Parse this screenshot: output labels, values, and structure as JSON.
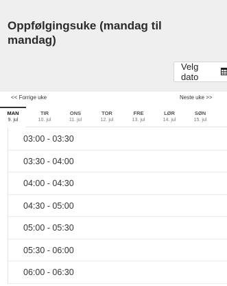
{
  "title": "Oppfølgingsuke (mandag til mandag)",
  "date_button": {
    "label": "Velg dato",
    "icon": "calendar-icon"
  },
  "week_nav": {
    "prev": "<< Forrige uke",
    "next": "Neste uke >>"
  },
  "days": [
    {
      "name": "MAN",
      "date": "9. jul"
    },
    {
      "name": "TIR",
      "date": "10. jul"
    },
    {
      "name": "ONS",
      "date": "11. jul"
    },
    {
      "name": "TOR",
      "date": "12. jul"
    },
    {
      "name": "FRE",
      "date": "13. jul"
    },
    {
      "name": "LØR",
      "date": "14. jul"
    },
    {
      "name": "SØN",
      "date": "15. jul"
    }
  ],
  "slots": [
    "03:00 - 03:30",
    "03:30 - 04:00",
    "04:00 - 04:30",
    "04:30 - 05:00",
    "05:00 - 05:30",
    "05:30 - 06:00",
    "06:00 - 06:30"
  ],
  "colors": {
    "header_bg": "#efefef",
    "text": "#222222",
    "border": "#e3e3e3"
  }
}
